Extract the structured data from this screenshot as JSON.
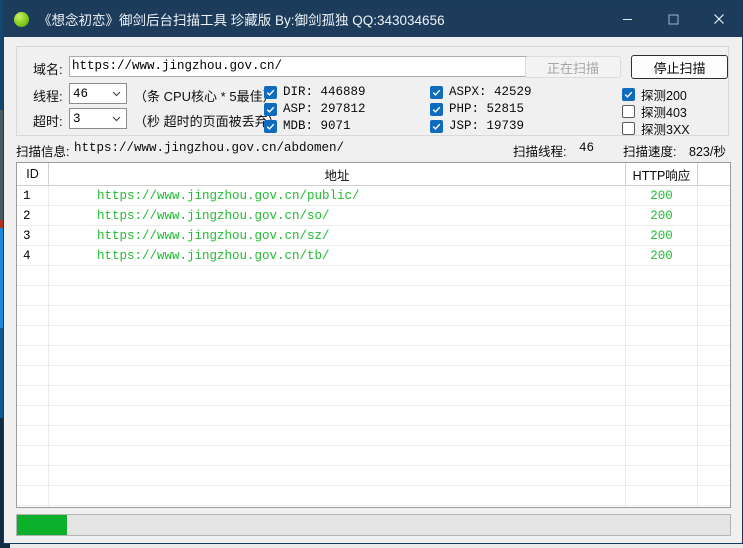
{
  "window": {
    "title": "《想念初恋》御剑后台扫描工具 珍藏版 By:御剑孤独 QQ:343034656",
    "icon": "green-circle-icon",
    "titlebar_color": "#1d3c5c",
    "controls": {
      "minimize": "minimize-icon",
      "maximize": "maximize-icon",
      "close": "close-icon"
    }
  },
  "settings": {
    "domain_label": "域名:",
    "domain_value": "https://www.jingzhou.gov.cn/",
    "domain_placeholder": "https://",
    "threads_label": "线程:",
    "threads_value": "46",
    "threads_hint": "（条 CPU核心 * 5最佳）",
    "timeout_label": "超时:",
    "timeout_value": "3",
    "timeout_hint": "（秒 超时的页面被丢弃）",
    "scanning_button": "正在扫描",
    "stop_button": "停止扫描",
    "dict_checks": [
      {
        "label": "DIR: 446889",
        "checked": true
      },
      {
        "label": "ASP: 297812",
        "checked": true
      },
      {
        "label": "MDB: 9071",
        "checked": true
      }
    ],
    "ext_checks": [
      {
        "label": "ASPX: 42529",
        "checked": true
      },
      {
        "label": "PHP: 52815",
        "checked": true
      },
      {
        "label": "JSP: 19739",
        "checked": true
      }
    ],
    "probe_checks": [
      {
        "label": "探测200",
        "checked": true
      },
      {
        "label": "探测403",
        "checked": false
      },
      {
        "label": "探测3XX",
        "checked": false
      }
    ]
  },
  "status": {
    "info_label": "扫描信息:",
    "info_value": "https://www.jingzhou.gov.cn/abdomen/",
    "threads_label": "扫描线程:",
    "threads_value": "46",
    "speed_label": "扫描速度:",
    "speed_value": "823/秒"
  },
  "table": {
    "headers": [
      "ID",
      "地址",
      "HTTP响应",
      ""
    ],
    "rows": [
      {
        "id": "1",
        "address": "https://www.jingzhou.gov.cn/public/",
        "code": "200"
      },
      {
        "id": "2",
        "address": "https://www.jingzhou.gov.cn/so/",
        "code": "200"
      },
      {
        "id": "3",
        "address": "https://www.jingzhou.gov.cn/sz/",
        "code": "200"
      },
      {
        "id": "4",
        "address": "https://www.jingzhou.gov.cn/tb/",
        "code": "200"
      }
    ],
    "empty_rows": 13
  },
  "progress": {
    "percent": 7,
    "fill_color": "#0db02b"
  },
  "colors": {
    "accent": "#0f6cbd",
    "result_green": "#22bb33",
    "titlebar": "#1d3c5c"
  }
}
